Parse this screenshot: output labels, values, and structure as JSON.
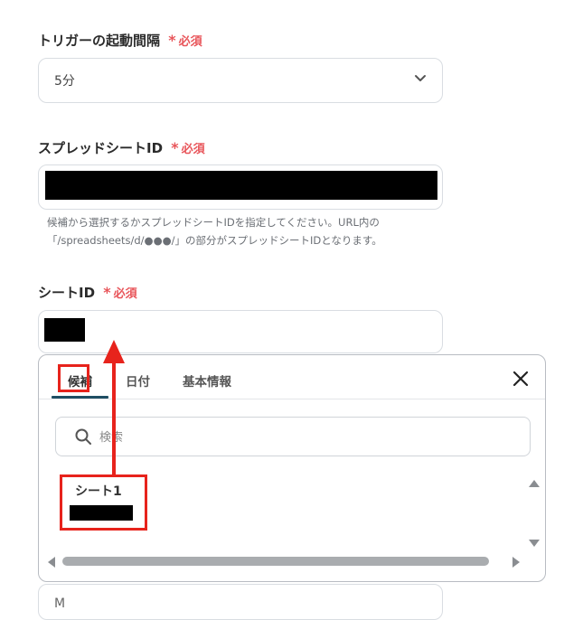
{
  "trigger": {
    "label": "トリガーの起動間隔",
    "required": "必須",
    "value": "5分"
  },
  "spreadsheet": {
    "label": "スプレッドシートID",
    "required": "必須",
    "help_line1": "候補から選択するかスプレッドシートIDを指定してください。URL内の",
    "help_line2": "「/spreadsheets/d/●●●/」の部分がスプレッドシートIDとなります。"
  },
  "sheet": {
    "label": "シートID",
    "required": "必須"
  },
  "picker": {
    "tabs": [
      "候補",
      "日付",
      "基本情報"
    ],
    "search_placeholder": "検索",
    "items": [
      {
        "label": "シート1"
      }
    ]
  },
  "next_field": {
    "text": "M"
  },
  "icons": {
    "chevron": "chevron-down-icon",
    "close": "close-icon",
    "search": "search-icon",
    "scroll_up": "scroll-up-icon",
    "scroll_down": "scroll-down-icon",
    "scroll_left": "scroll-left-icon",
    "scroll_right": "scroll-right-icon"
  },
  "colors": {
    "required": "#e8555a",
    "annotation": "#e7231c",
    "active_tab": "#1f4e63",
    "redaction": "#000000"
  }
}
